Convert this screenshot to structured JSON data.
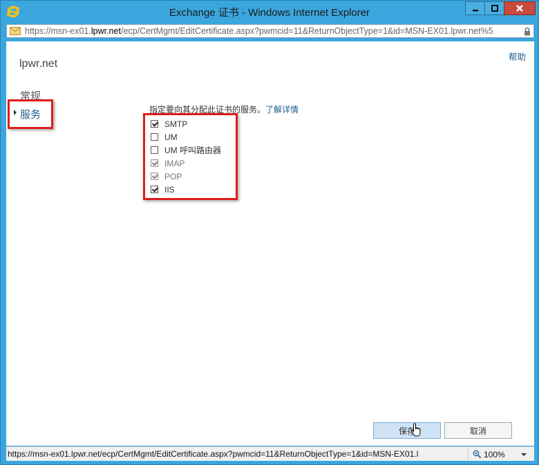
{
  "window": {
    "title": "Exchange 证书 - Windows Internet Explorer"
  },
  "address_bar": {
    "url_prefix": "https://msn-ex01.",
    "url_domain": "lpwr.net",
    "url_rest": "/ecp/CertMgmt/EditCertificate.aspx?pwmcid=11&ReturnObjectType=1&id=MSN-EX01.lpwr.net%5"
  },
  "page": {
    "help_label": "帮助",
    "org_name": "lpwr.net",
    "nav": {
      "general": "常规",
      "services": "服务"
    },
    "instruction": "指定要向其分配此证书的服务。",
    "learn_more": "了解详情",
    "services": [
      {
        "label": "SMTP",
        "checked": true,
        "disabled": false
      },
      {
        "label": "UM",
        "checked": false,
        "disabled": false
      },
      {
        "label": "UM 呼叫路由器",
        "checked": false,
        "disabled": false
      },
      {
        "label": "IMAP",
        "checked": true,
        "disabled": true
      },
      {
        "label": "POP",
        "checked": true,
        "disabled": true
      },
      {
        "label": "IIS",
        "checked": true,
        "disabled": false
      }
    ],
    "save_label": "保存",
    "cancel_label": "取消"
  },
  "status_bar": {
    "text": "https://msn-ex01.lpwr.net/ecp/CertMgmt/EditCertificate.aspx?pwmcid=11&ReturnObjectType=1&id=MSN-EX01.l",
    "zoom": "100%"
  },
  "colors": {
    "accent_link": "#1f5e8f",
    "highlight_box": "#e01b1b",
    "window_frame": "#3aa6dd"
  }
}
